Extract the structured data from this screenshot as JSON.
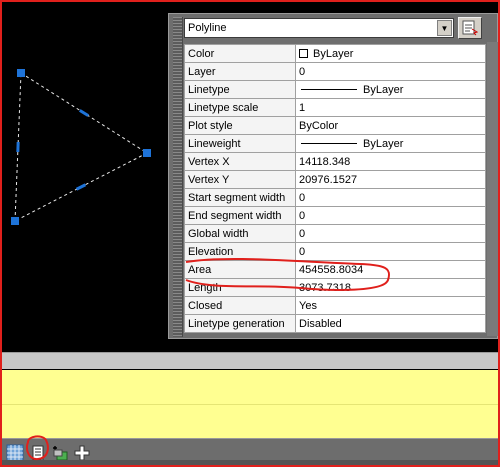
{
  "palette": {
    "object_type": "Polyline",
    "rows": [
      {
        "label": "Color",
        "value": "ByLayer",
        "kind": "color"
      },
      {
        "label": "Layer",
        "value": "0",
        "kind": "text"
      },
      {
        "label": "Linetype",
        "value": "ByLayer",
        "kind": "line"
      },
      {
        "label": "Linetype scale",
        "value": "1",
        "kind": "text"
      },
      {
        "label": "Plot style",
        "value": "ByColor",
        "kind": "text"
      },
      {
        "label": "Lineweight",
        "value": "ByLayer",
        "kind": "line"
      },
      {
        "label": "Vertex X",
        "value": "14118.348",
        "kind": "text"
      },
      {
        "label": "Vertex Y",
        "value": "20976.1527",
        "kind": "text"
      },
      {
        "label": "Start segment width",
        "value": "0",
        "kind": "text"
      },
      {
        "label": "End segment width",
        "value": "0",
        "kind": "text"
      },
      {
        "label": "Global width",
        "value": "0",
        "kind": "text"
      },
      {
        "label": "Elevation",
        "value": "0",
        "kind": "text"
      },
      {
        "label": "Area",
        "value": "454558.8034",
        "kind": "text"
      },
      {
        "label": "Length",
        "value": "3073.7318",
        "kind": "text"
      },
      {
        "label": "Closed",
        "value": "Yes",
        "kind": "text"
      },
      {
        "label": "Linetype generation",
        "value": "Disabled",
        "kind": "text"
      }
    ]
  },
  "colors": {
    "annotation_red": "#e0201c",
    "grip_blue": "#1e73d8",
    "command_bg": "#ffff91",
    "viewport_bg": "#000000"
  },
  "statusbar": {
    "buttons": [
      {
        "icon": "grid-display-icon"
      },
      {
        "icon": "quick-properties-icon"
      },
      {
        "icon": "layers-add-icon"
      },
      {
        "icon": "add-icon"
      }
    ]
  }
}
